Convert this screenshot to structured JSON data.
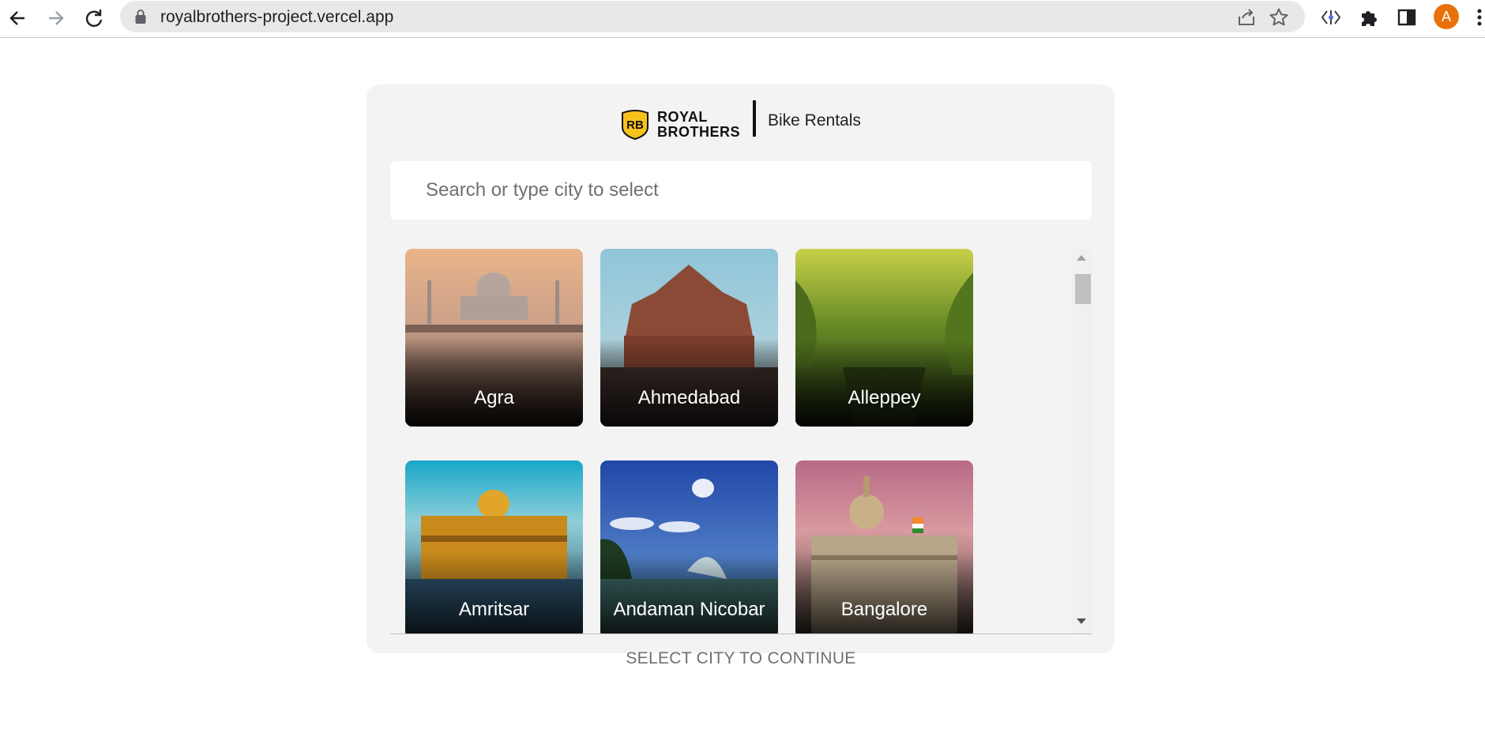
{
  "browser": {
    "url": "royalbrothers-project.vercel.app",
    "profile_initial": "A",
    "icons": [
      "back-icon",
      "forward-icon",
      "reload-icon",
      "lock-icon",
      "share-icon",
      "star-icon",
      "extension-icon",
      "puzzle-icon",
      "side-panel-icon",
      "menu-icon"
    ]
  },
  "header": {
    "logo_badge": "RB",
    "logo_line1": "ROYAL",
    "logo_line2": "BROTHERS",
    "subtitle": "Bike Rentals"
  },
  "search": {
    "placeholder": "Search or type city to select",
    "value": ""
  },
  "cities": [
    {
      "name": "Agra"
    },
    {
      "name": "Ahmedabad"
    },
    {
      "name": "Alleppey"
    },
    {
      "name": "Amritsar"
    },
    {
      "name": "Andaman Nicobar"
    },
    {
      "name": "Bangalore"
    }
  ],
  "footer": {
    "continue_label": "SELECT CITY TO CONTINUE"
  },
  "colors": {
    "brand_yellow": "#f7c21c",
    "panel_bg": "#f3f3f3",
    "avatar": "#e8710a"
  }
}
